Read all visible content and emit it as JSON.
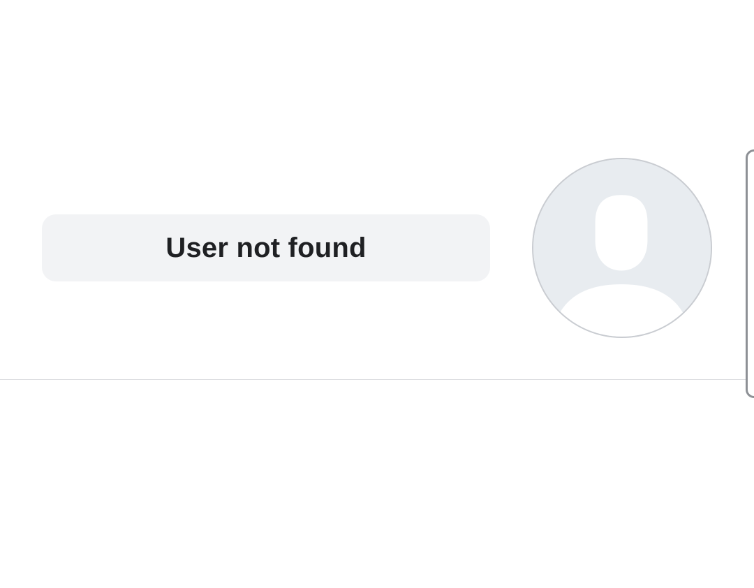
{
  "profile": {
    "status_text": "User not found",
    "avatar_icon": "default-avatar-icon"
  },
  "colors": {
    "background": "#ffffff",
    "pill_background": "#f2f3f5",
    "text": "#1f2023",
    "avatar_background": "#e8ecf0",
    "avatar_border": "#c9ccd1",
    "divider": "#dcdde0",
    "panel_edge": "#8d9095"
  }
}
